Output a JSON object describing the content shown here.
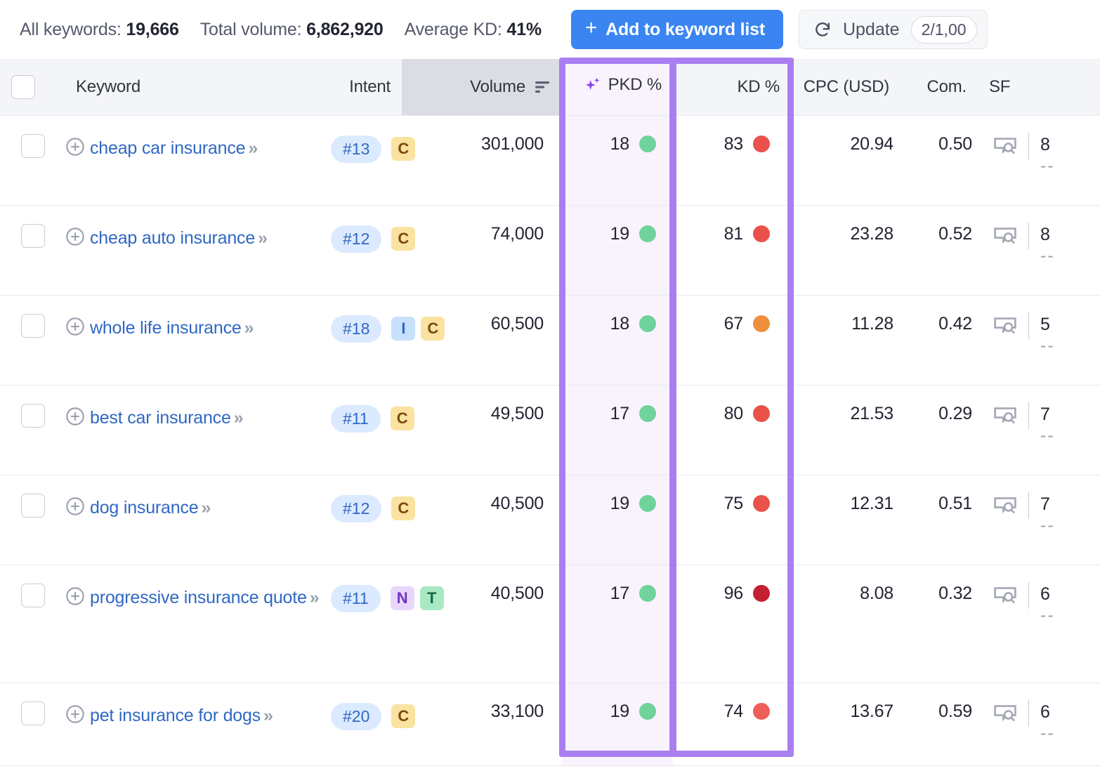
{
  "topbar": {
    "stats": [
      {
        "label": "All keywords:",
        "value": "19,666"
      },
      {
        "label": "Total volume:",
        "value": "6,862,920"
      },
      {
        "label": "Average KD:",
        "value": "41%"
      }
    ],
    "add_button": {
      "label": "Add to keyword list",
      "plus": "+",
      "color": "#3a85f2"
    },
    "update_button": {
      "label": "Update",
      "icon": "refresh-icon",
      "badge": "2/1,00"
    }
  },
  "table": {
    "columns": [
      {
        "key": "checkbox",
        "label": ""
      },
      {
        "key": "keyword",
        "label": "Keyword"
      },
      {
        "key": "intent",
        "label": "Intent"
      },
      {
        "key": "volume",
        "label": "Volume",
        "sorted": "desc",
        "sort_icon": "sort-desc-icon"
      },
      {
        "key": "pkd",
        "label": "PKD %",
        "icon": "sparkle-icon",
        "highlighted": true
      },
      {
        "key": "kd",
        "label": "KD %",
        "highlighted": true
      },
      {
        "key": "cpc",
        "label": "CPC (USD)"
      },
      {
        "key": "com",
        "label": "Com."
      },
      {
        "key": "sf",
        "label": "SF"
      }
    ],
    "highlight_color": "#a97ff0",
    "rows": [
      {
        "keyword": "cheap car insurance",
        "position": "#13",
        "intents": [
          "C"
        ],
        "volume": "301,000",
        "pkd": "18",
        "pkd_color": "#6fd39b",
        "kd": "83",
        "kd_color": "#e8524a",
        "cpc": "20.94",
        "com": "0.50",
        "sf_primary": "8",
        "sf_secondary": "--"
      },
      {
        "keyword": "cheap auto insurance",
        "position": "#12",
        "intents": [
          "C"
        ],
        "volume": "74,000",
        "pkd": "19",
        "pkd_color": "#6fd39b",
        "kd": "81",
        "kd_color": "#e8524a",
        "cpc": "23.28",
        "com": "0.52",
        "sf_primary": "8",
        "sf_secondary": "--"
      },
      {
        "keyword": "whole life insurance",
        "position": "#18",
        "intents": [
          "I",
          "C"
        ],
        "volume": "60,500",
        "pkd": "18",
        "pkd_color": "#6fd39b",
        "kd": "67",
        "kd_color": "#ef8f3c",
        "cpc": "11.28",
        "com": "0.42",
        "sf_primary": "5",
        "sf_secondary": "--"
      },
      {
        "keyword": "best car insurance",
        "position": "#11",
        "intents": [
          "C"
        ],
        "volume": "49,500",
        "pkd": "17",
        "pkd_color": "#6fd39b",
        "kd": "80",
        "kd_color": "#e8524a",
        "cpc": "21.53",
        "com": "0.29",
        "sf_primary": "7",
        "sf_secondary": "--"
      },
      {
        "keyword": "dog insurance",
        "position": "#12",
        "intents": [
          "C"
        ],
        "volume": "40,500",
        "pkd": "19",
        "pkd_color": "#6fd39b",
        "kd": "75",
        "kd_color": "#e8524a",
        "cpc": "12.31",
        "com": "0.51",
        "sf_primary": "7",
        "sf_secondary": "--"
      },
      {
        "keyword": "progressive insurance quote",
        "position": "#11",
        "intents": [
          "N",
          "T"
        ],
        "volume": "40,500",
        "pkd": "17",
        "pkd_color": "#6fd39b",
        "kd": "96",
        "kd_color": "#c32030",
        "cpc": "8.08",
        "com": "0.32",
        "sf_primary": "6",
        "sf_secondary": "--"
      },
      {
        "keyword": "pet insurance for dogs",
        "position": "#20",
        "intents": [
          "C"
        ],
        "volume": "33,100",
        "pkd": "19",
        "pkd_color": "#6fd39b",
        "kd": "74",
        "kd_color": "#ee5f5a",
        "cpc": "13.67",
        "com": "0.59",
        "sf_primary": "6",
        "sf_secondary": "--"
      }
    ],
    "keyword_expand_chevron": "»"
  }
}
